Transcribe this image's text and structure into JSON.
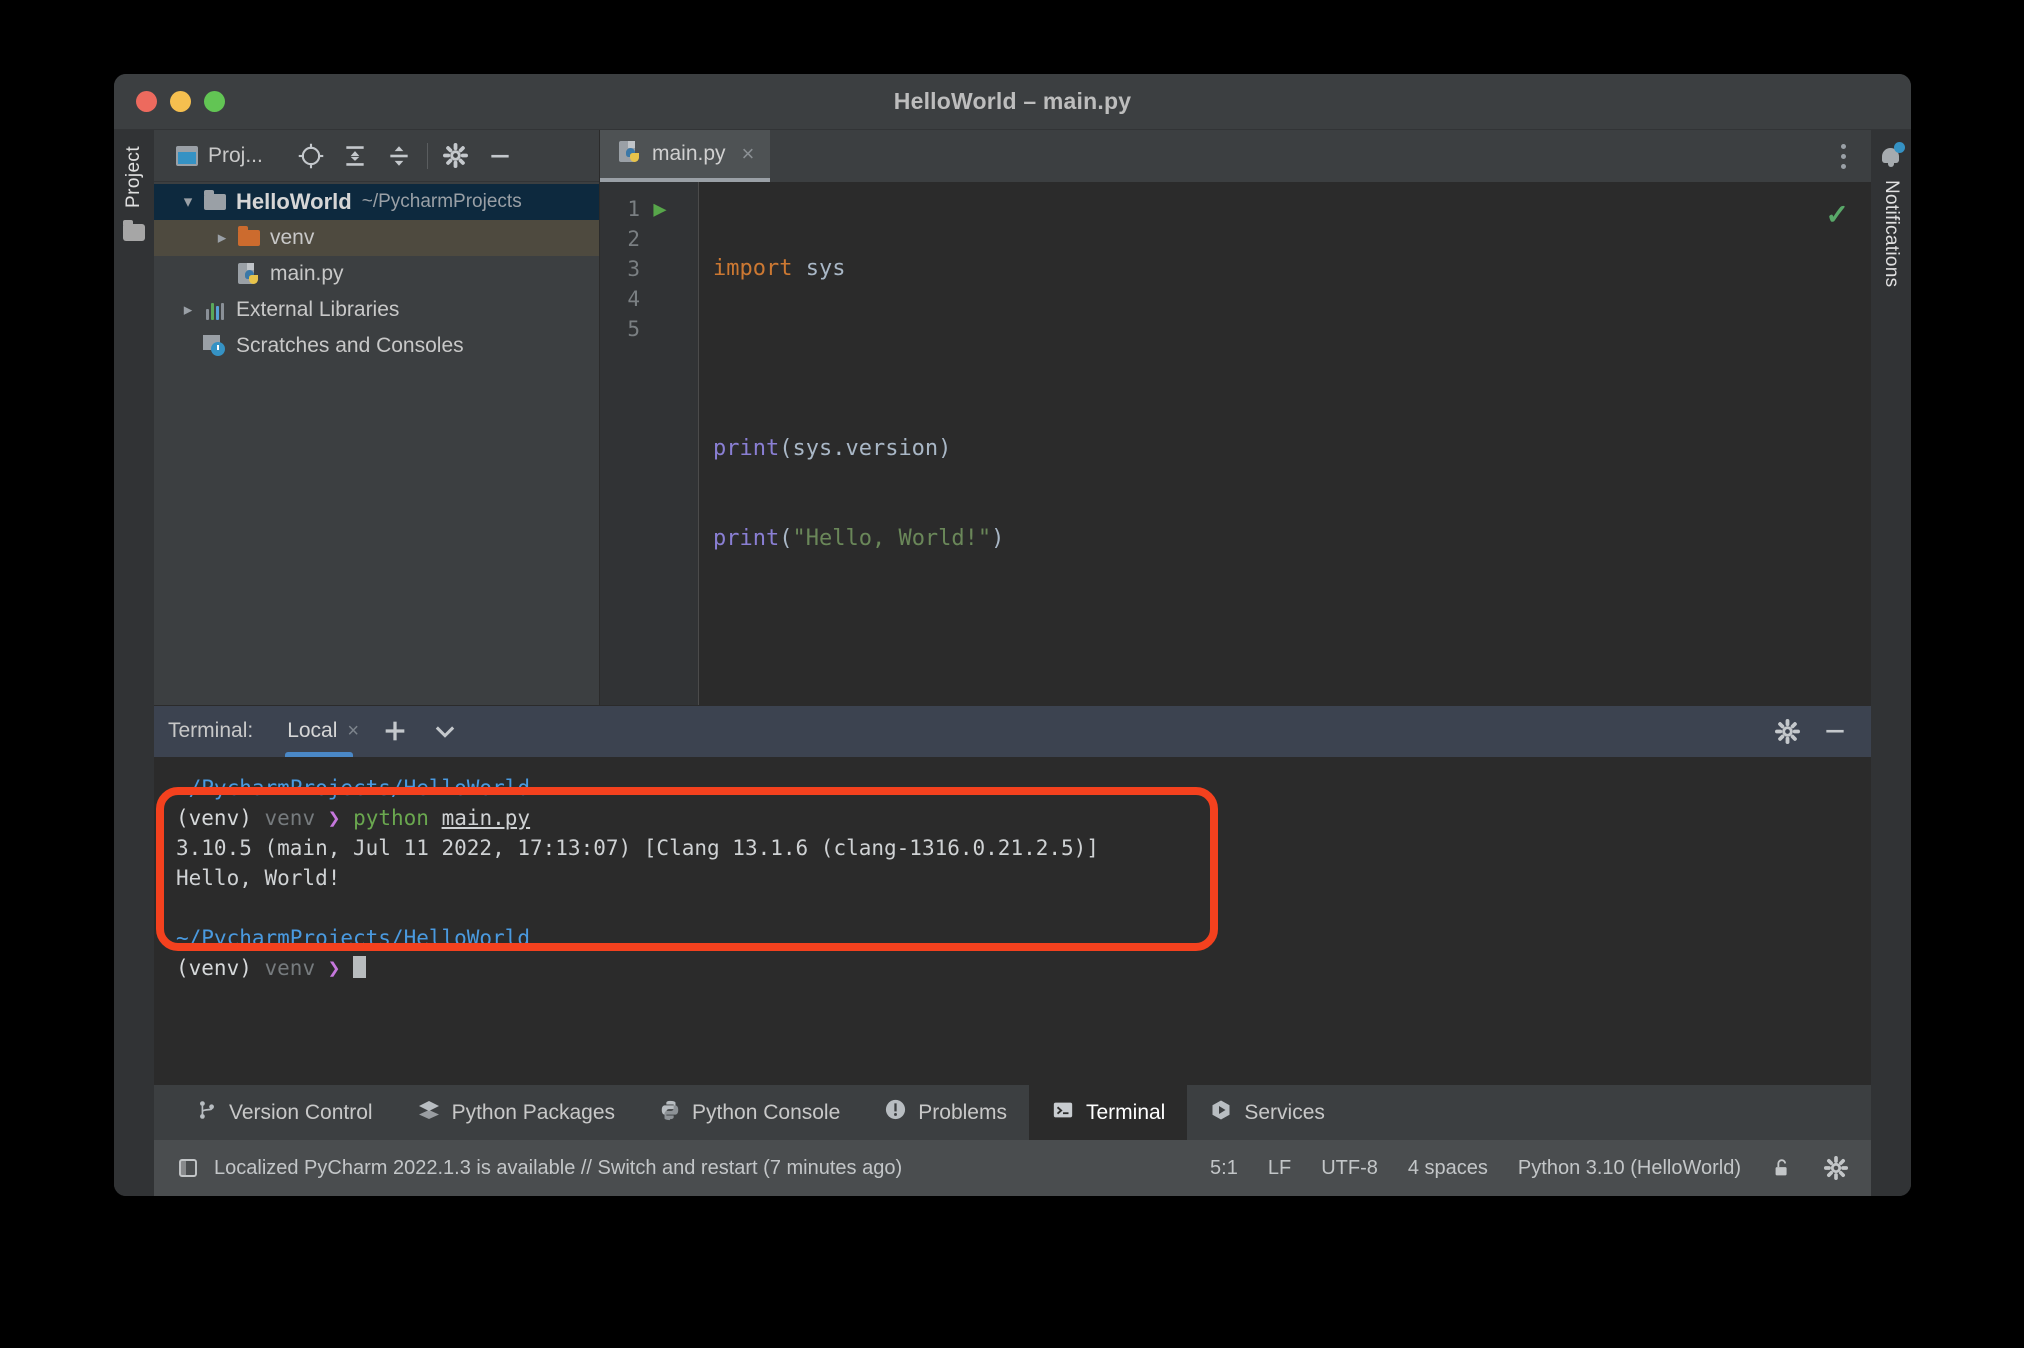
{
  "window": {
    "title": "HelloWorld – main.py",
    "traffic_lights": [
      "close",
      "minimize",
      "zoom"
    ]
  },
  "left_strip": {
    "project_label": "Project",
    "folder_icon": "folder-icon"
  },
  "right_strip": {
    "notifications_label": "Notifications",
    "bell_icon": "bell-icon"
  },
  "project_panel": {
    "toolbar": {
      "title": "Proj...",
      "window_icon": "window-icon",
      "locate_icon": "locate-file-icon",
      "expand_icon": "expand-all-icon",
      "collapse_icon": "collapse-all-icon",
      "settings_icon": "gear-icon",
      "hide_icon": "minimize-icon"
    },
    "tree": [
      {
        "name": "HelloWorld",
        "path": "~/PycharmProjects",
        "icon": "folder-icon",
        "arrow": "chevron-down",
        "state": "selected",
        "indent": 0
      },
      {
        "name": "venv",
        "path": "",
        "icon": "folder-orange-icon",
        "arrow": "chevron-right",
        "state": "hover",
        "indent": 1
      },
      {
        "name": "main.py",
        "path": "",
        "icon": "python-file-icon",
        "arrow": "none",
        "state": "normal",
        "indent": 1
      },
      {
        "name": "External Libraries",
        "path": "",
        "icon": "libraries-icon",
        "arrow": "chevron-right",
        "state": "normal",
        "indent": 0
      },
      {
        "name": "Scratches and Consoles",
        "path": "",
        "icon": "scratches-icon",
        "arrow": "none",
        "state": "normal",
        "indent": 0
      }
    ]
  },
  "editor": {
    "tab": {
      "label": "main.py",
      "icon": "python-file-icon",
      "close": "×"
    },
    "overflow_icon": "more-options-icon",
    "inspection_status": "✓",
    "lines": [
      {
        "num": "1",
        "gutter_icon": "run-arrow-icon",
        "tokens": [
          {
            "t": "import",
            "c": "kw"
          },
          {
            "t": " sys",
            "c": "pl"
          }
        ]
      },
      {
        "num": "2",
        "gutter_icon": "",
        "tokens": []
      },
      {
        "num": "3",
        "gutter_icon": "",
        "tokens": [
          {
            "t": "print",
            "c": "fn"
          },
          {
            "t": "(sys.version)",
            "c": "pl"
          }
        ]
      },
      {
        "num": "4",
        "gutter_icon": "",
        "tokens": [
          {
            "t": "print",
            "c": "fn"
          },
          {
            "t": "(",
            "c": "pl"
          },
          {
            "t": "\"Hello, World!\"",
            "c": "str"
          },
          {
            "t": ")",
            "c": "pl"
          }
        ]
      },
      {
        "num": "5",
        "gutter_icon": "",
        "tokens": []
      }
    ]
  },
  "terminal": {
    "toolbar": {
      "title": "Terminal:",
      "tab_label": "Local",
      "tab_close": "×",
      "new_session_icon": "plus-icon",
      "dropdown_icon": "chevron-down-icon",
      "settings_icon": "gear-icon",
      "hide_icon": "minimize-icon"
    },
    "highlighted_block": {
      "path": "~/PycharmProjects/HelloWorld",
      "prompt_env": "(venv)",
      "prompt_dir": "venv",
      "prompt_chevron": "❯",
      "command": "python",
      "command_arg": "main.py",
      "output_version": "3.10.5 (main, Jul 11 2022, 17:13:07) [Clang 13.1.6 (clang-1316.0.21.2.5)]",
      "output_hello": "Hello, World!",
      "highlight_color": "#f4411e"
    },
    "current_prompt": {
      "path": "~/PycharmProjects/HelloWorld",
      "prompt_env": "(venv)",
      "prompt_dir": "venv",
      "prompt_chevron": "❯"
    }
  },
  "bottom_toolwindows": [
    {
      "label": "Version Control",
      "icon": "branch-icon",
      "active": false
    },
    {
      "label": "Python Packages",
      "icon": "packages-icon",
      "active": false
    },
    {
      "label": "Python Console",
      "icon": "python-icon",
      "active": false
    },
    {
      "label": "Problems",
      "icon": "problems-icon",
      "active": false
    },
    {
      "label": "Terminal",
      "icon": "terminal-icon",
      "active": true
    },
    {
      "label": "Services",
      "icon": "services-icon",
      "active": false
    }
  ],
  "statusbar": {
    "memory_icon": "sidebar-icon",
    "message": "Localized PyCharm 2022.1.3 is available // Switch and restart (7 minutes ago)",
    "caret": "5:1",
    "line_separator": "LF",
    "encoding": "UTF-8",
    "indent": "4 spaces",
    "interpreter": "Python 3.10 (HelloWorld)",
    "lock_icon": "unlocked-icon",
    "settings_icon": "gear-icon"
  }
}
